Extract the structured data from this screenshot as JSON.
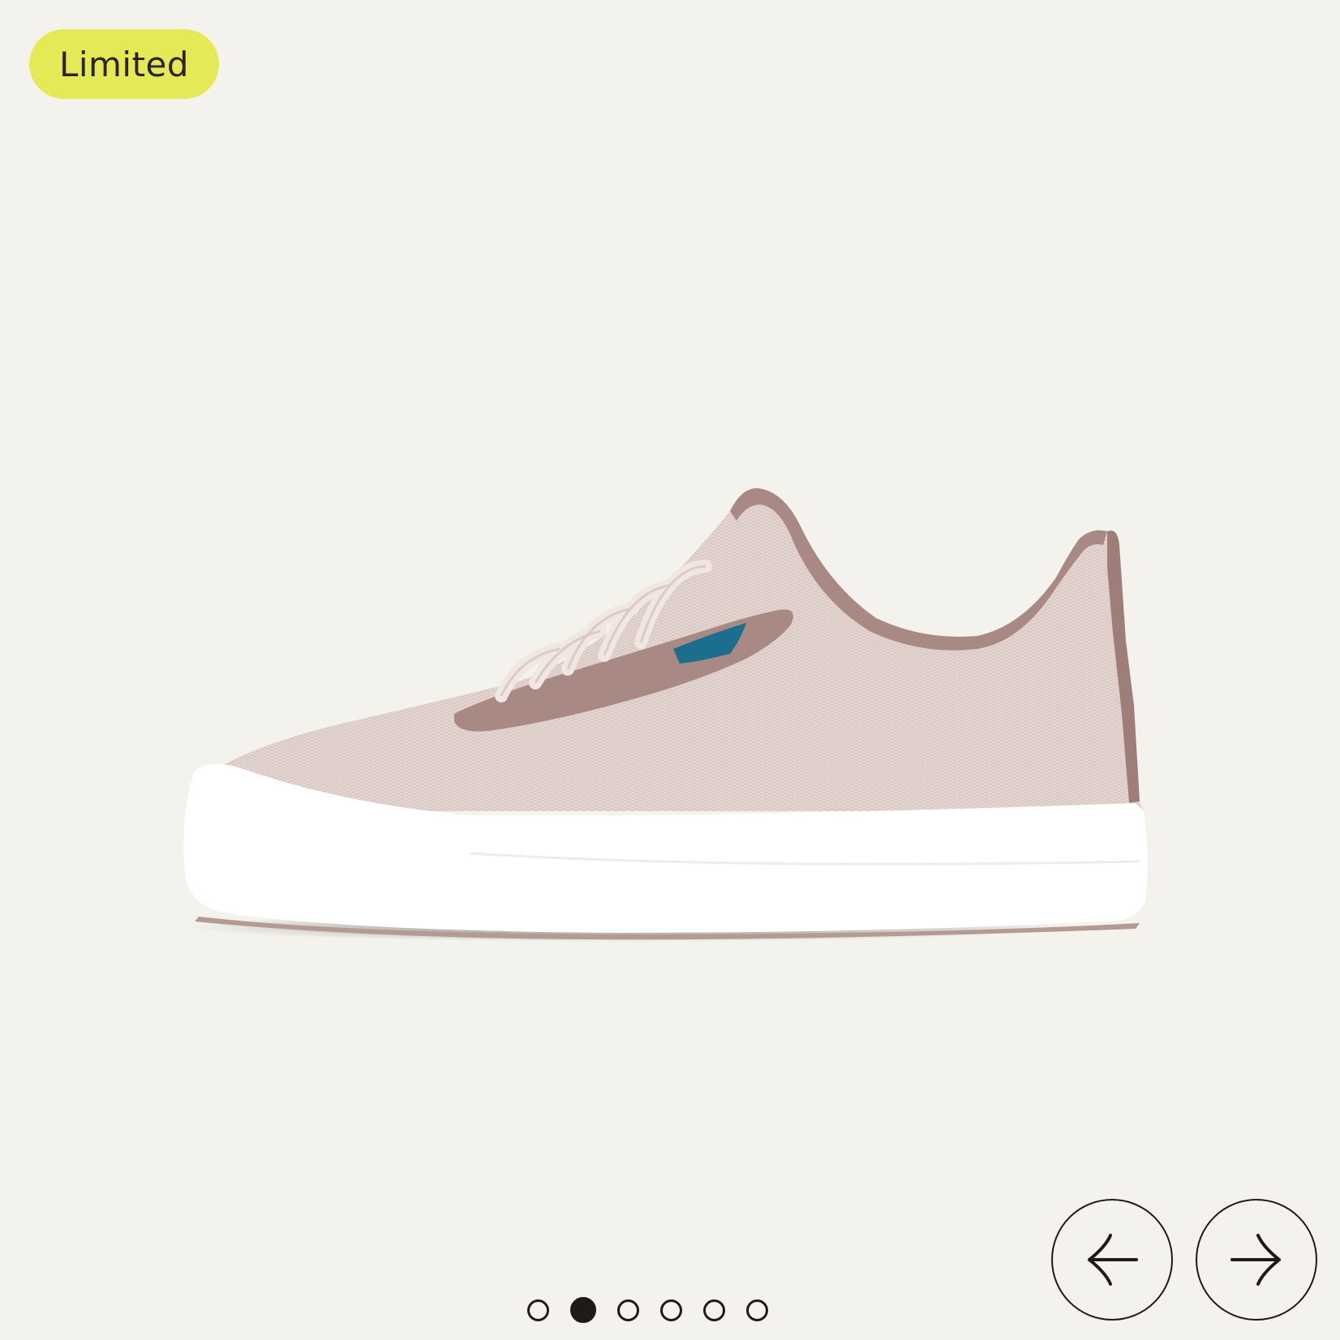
{
  "badge": {
    "label": "Limited",
    "color": "#e3ea56"
  },
  "gallery": {
    "image_icon": "sneaker-product-image",
    "slide_count": 6,
    "active_slide": 2,
    "slides": [
      {
        "name": "gallery-dot-1",
        "active": false
      },
      {
        "name": "gallery-dot-2",
        "active": true
      },
      {
        "name": "gallery-dot-3",
        "active": false
      },
      {
        "name": "gallery-dot-4",
        "active": false
      },
      {
        "name": "gallery-dot-5",
        "active": false
      },
      {
        "name": "gallery-dot-6",
        "active": false
      }
    ],
    "prev_icon": "arrow-left-icon",
    "next_icon": "arrow-right-icon"
  },
  "colors": {
    "background": "#f4f2ec",
    "shoe_upper": "#e6d7d3",
    "shoe_trim": "#a98984",
    "sole": "#ffffff",
    "accent_tab": "#1b6f8d",
    "control_stroke": "#1f1a17"
  }
}
